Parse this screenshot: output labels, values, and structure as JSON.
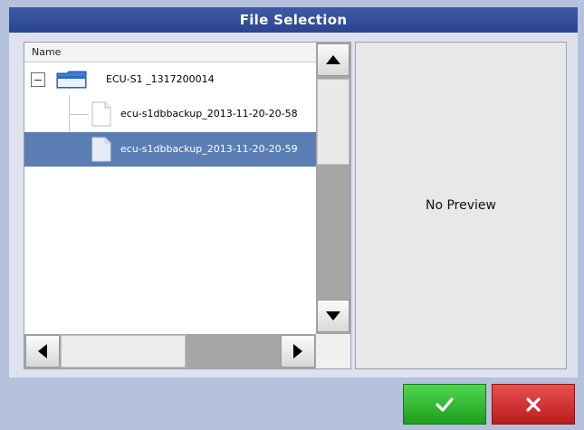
{
  "window": {
    "title": "File Selection"
  },
  "file_list": {
    "column_header": "Name",
    "items": [
      {
        "label": "ECU-S1 _1317200014",
        "type": "folder",
        "expanded": true
      },
      {
        "label": "ecu-s1dbbackup_2013-11-20-20-58",
        "type": "file",
        "selected": false
      },
      {
        "label": "ecu-s1dbbackup_2013-11-20-20-59",
        "type": "file",
        "selected": true
      }
    ]
  },
  "preview": {
    "text": "No Preview"
  },
  "buttons": {
    "confirm_icon": "checkmark-icon",
    "cancel_icon": "x-icon"
  },
  "colors": {
    "title_bar": "#2f4b98",
    "selection": "#5a7eb3",
    "confirm": "#2db82d",
    "cancel": "#d12b2b"
  }
}
